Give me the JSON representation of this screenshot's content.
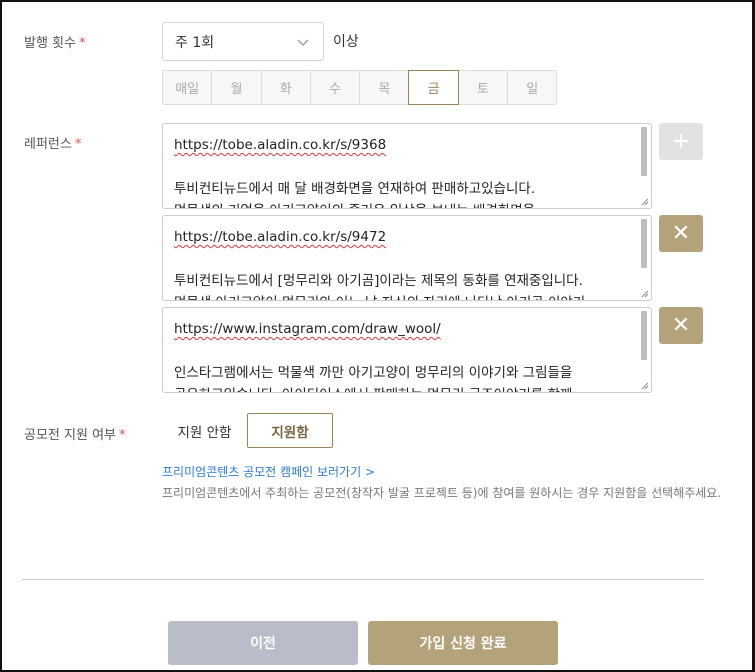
{
  "frequency": {
    "label": "발행 횟수",
    "required_mark": "*",
    "selected": "주 1회",
    "suffix": "이상",
    "days": [
      "매일",
      "월",
      "화",
      "수",
      "목",
      "금",
      "토",
      "일"
    ],
    "selected_day": "금"
  },
  "reference": {
    "label": "레퍼런스",
    "required_mark": "*",
    "add_label": "+",
    "remove_label": "✕",
    "items": [
      {
        "url": "https://tobe.aladin.co.kr/s/9368",
        "line2": "투비컨티뉴드에서 매 달 배경화면을 연재하여 판매하고있습니다.",
        "line3": "먹물색의 기억을 아기고양이의 즐거운 일상을 보내는 배경화면을"
      },
      {
        "url": "https://tobe.aladin.co.kr/s/9472",
        "line2": "투비컨티뉴드에서 [멍무리와 아기곰]이라는 제목의 동화를 연재중입니다.",
        "line3": "먹물색 아기고양이 멍무리와 어느 날 자신의 자리에 나타난 아기곰 이야기"
      },
      {
        "url": "https://www.instagram.com/draw_wool/",
        "line2": "인스타그램에서는 먹물색 까만 아기고양이 멍무리의 이야기와 그림들을",
        "line3": "공유하고있습니다. 아이디어스에서 판매하는 멍무리 굿즈이야기를 함께"
      }
    ]
  },
  "contest": {
    "label": "공모전 지원 여부",
    "required_mark": "*",
    "option_no": "지원 안함",
    "option_yes": "지원함",
    "link": "프리미엄콘텐츠 공모전 캠페인 보러가기 >",
    "desc": "프리미엄콘텐츠에서 주최하는 공모전(창작자 발굴 프로젝트 등)에 참여를 원하시는 경우 지원함을 선택해주세요."
  },
  "actions": {
    "prev": "이전",
    "submit": "가입 신청 완료"
  },
  "colors": {
    "accent": "#9c8458",
    "primary_button": "#b4a27b",
    "secondary_button": "#b8bdc9",
    "required": "#d9534f",
    "link": "#2b7bd6"
  }
}
